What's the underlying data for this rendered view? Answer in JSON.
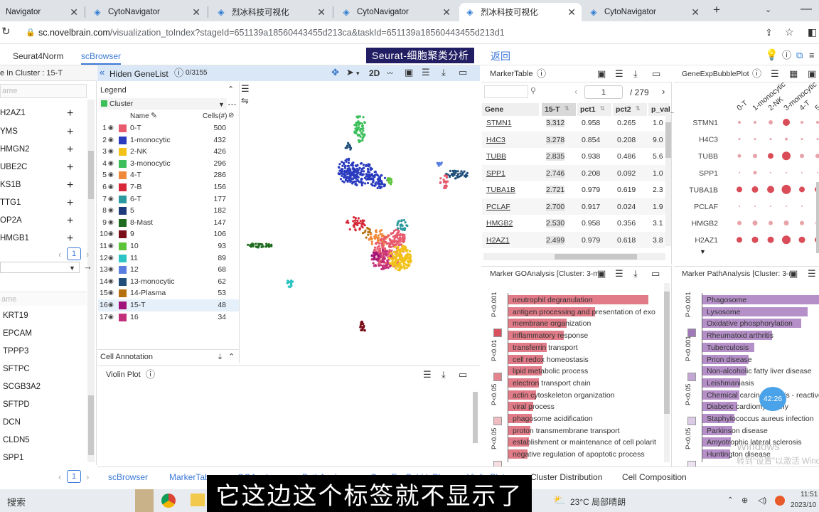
{
  "browser": {
    "tabs": [
      {
        "label": "Navigator",
        "icon": "cyto-icon"
      },
      {
        "label": "CytoNavigator",
        "icon": "cyto-icon"
      },
      {
        "label": "烈冰科技可视化",
        "icon": "cyto-icon"
      },
      {
        "label": "CytoNavigator",
        "icon": "cyto-icon"
      },
      {
        "label": "烈冰科技可视化",
        "icon": "cyto-icon"
      },
      {
        "label": "CytoNavigator",
        "icon": "cyto-icon"
      }
    ],
    "url_host": "sc.novelbrain.com",
    "url_path": "/visualization_toIndex?stageId=651139a18560443455d213ca&taskId=651139a18560443455d213d1"
  },
  "app": {
    "tabs": [
      "Seurat4Norm",
      "scBrowser"
    ],
    "title": "Seurat-细胞聚类分析",
    "back": "返回"
  },
  "left_panel": {
    "header": "e In Cluster : 15-T",
    "search_placeholder": "ame",
    "genes_top": [
      "H2AZ1",
      "YMS",
      "HMGN2",
      "UBE2C",
      "KS1B",
      "TTG1",
      "OP2A",
      "HMGB1"
    ],
    "page": "1",
    "search2_placeholder": "ame",
    "genes_bottom": [
      "KRT19",
      "EPCAM",
      "TPPP3",
      "SFTPC",
      "SCGB3A2",
      "SFTPD",
      "DCN",
      "CLDN5",
      "SPP1"
    ],
    "page2": "1"
  },
  "umap_toolbar": {
    "hide_label": "Hiden GeneList",
    "count": "0/3155",
    "mode": "2D"
  },
  "legend": {
    "title": "Legend",
    "group": "Cluster",
    "col_name": "Name",
    "col_cells": "Cells(#)",
    "rows": [
      {
        "n": "1",
        "name": "0-T",
        "cells": "500",
        "color": "#e85a6e"
      },
      {
        "n": "2",
        "name": "1-monocytic",
        "cells": "432",
        "color": "#2a3bbf"
      },
      {
        "n": "3",
        "name": "2-NK",
        "cells": "426",
        "color": "#f2c21b"
      },
      {
        "n": "4",
        "name": "3-monocytic",
        "cells": "296",
        "color": "#3cbf5a"
      },
      {
        "n": "5",
        "name": "4-T",
        "cells": "286",
        "color": "#f08a3a"
      },
      {
        "n": "6",
        "name": "7-B",
        "cells": "156",
        "color": "#d62838"
      },
      {
        "n": "7",
        "name": "6-T",
        "cells": "177",
        "color": "#2a9aa0"
      },
      {
        "n": "8",
        "name": "5",
        "cells": "182",
        "color": "#1f3a7a"
      },
      {
        "n": "9",
        "name": "8-Mast",
        "cells": "147",
        "color": "#1f6b1f"
      },
      {
        "n": "10",
        "name": "9",
        "cells": "106",
        "color": "#7a0f1a"
      },
      {
        "n": "11",
        "name": "10",
        "cells": "93",
        "color": "#5dc43a"
      },
      {
        "n": "12",
        "name": "11",
        "cells": "89",
        "color": "#2cc4c4"
      },
      {
        "n": "13",
        "name": "12",
        "cells": "68",
        "color": "#5a7ee0"
      },
      {
        "n": "14",
        "name": "13-monocytic",
        "cells": "62",
        "color": "#1f4f7a"
      },
      {
        "n": "15",
        "name": "14-Plasma",
        "cells": "53",
        "color": "#b5710f"
      },
      {
        "n": "16",
        "name": "15-T",
        "cells": "48",
        "color": "#a0127a"
      },
      {
        "n": "17",
        "name": "16",
        "cells": "34",
        "color": "#c2307a"
      }
    ],
    "cell_annotation": "Cell Annotation",
    "violin": "Violin Plot"
  },
  "marker_table": {
    "title": "MarkerTable",
    "page": "1",
    "total": "/ 279",
    "cols": [
      "Gene",
      "15-T",
      "pct1",
      "pct2",
      "p_val_"
    ],
    "rows": [
      [
        "STMN1",
        "3.312",
        "0.958",
        "0.265",
        "1.0"
      ],
      [
        "H4C3",
        "3.278",
        "0.854",
        "0.208",
        "9.0"
      ],
      [
        "TUBB",
        "2.835",
        "0.938",
        "0.486",
        "5.6"
      ],
      [
        "SPP1",
        "2.746",
        "0.208",
        "0.092",
        "1.0"
      ],
      [
        "TUBA1B",
        "2.721",
        "0.979",
        "0.619",
        "2.3"
      ],
      [
        "PCLAF",
        "2.700",
        "0.917",
        "0.024",
        "1.9"
      ],
      [
        "HMGB2",
        "2.530",
        "0.958",
        "0.356",
        "3.1"
      ],
      [
        "H2AZ1",
        "2.499",
        "0.979",
        "0.618",
        "3.8"
      ],
      [
        "TYMS",
        "",
        "",
        "",
        ""
      ]
    ]
  },
  "bubble": {
    "title": "GeneExpBubblePlot",
    "cols": [
      "0-T",
      "1-monocytic",
      "2-NK",
      "3-monocytic",
      "4-T",
      "5-P"
    ],
    "genes": [
      "STMN1",
      "H4C3",
      "TUBB",
      "SPP1",
      "TUBA1B",
      "PCLAF",
      "HMGB2",
      "H2AZ1"
    ]
  },
  "go": {
    "title": "Marker GOAnalysis [Cluster: 3-m",
    "terms": [
      "neutrophil degranulation",
      "antigen processing and presentation of exo",
      "membrane organization",
      "inflammatory response",
      "transferrin transport",
      "cell redox homeostasis",
      "lipid metabolic process",
      "electron transport chain",
      "actin cytoskeleton organization",
      "viral process",
      "phagosome acidification",
      "proton transmembrane transport",
      "establishment or maintenance of cell polarit",
      "negative regulation of apoptotic process"
    ],
    "values": [
      1.0,
      0.62,
      0.42,
      0.4,
      0.28,
      0.25,
      0.24,
      0.22,
      0.2,
      0.18,
      0.17,
      0.16,
      0.15,
      0.14
    ],
    "pticks": [
      "P<0.001",
      "P<0.01",
      "P<0.05",
      "P<0.05"
    ]
  },
  "pathway": {
    "title": "Marker PathAnalysis [Cluster: 3-m",
    "terms": [
      "Phagosome",
      "Lysosome",
      "Oxidative phosphorylation",
      "Rheumatoid arthritis",
      "Tuberculosis",
      "Prion disease",
      "Non-alcoholic fatty liver disease",
      "Leishmaniasis",
      "Chemical carcinogenesis - reactive",
      "Diabetic cardiomyopathy",
      "Staphylococcus aureus infection",
      "Parkinson disease",
      "Amyotrophic lateral sclerosis",
      "Huntington disease"
    ],
    "values": [
      1.0,
      0.9,
      0.85,
      0.6,
      0.45,
      0.4,
      0.38,
      0.33,
      0.32,
      0.3,
      0.28,
      0.26,
      0.25,
      0.24
    ],
    "pticks": [
      "P<0.001",
      "P<0.001",
      "P<0.05",
      "P<0.05"
    ]
  },
  "bottom_tabs": [
    "scBrowser",
    "MarkerTab",
    "GOAnal",
    "PathAnal",
    "GeneExpBubblePl",
    "Violin Plot",
    "Cluster Distribution",
    "Cell Composition"
  ],
  "overlay": {
    "timer": "42:26",
    "watermark": "Windows",
    "watermark_sub": "转到\"设置\"以激活 Windows。",
    "subtitle": "它这边这个标签就不显示了"
  },
  "taskbar": {
    "search": "搜索",
    "weather": "23°C 局部晴朗",
    "time": "11:51",
    "date": "2023/10"
  }
}
